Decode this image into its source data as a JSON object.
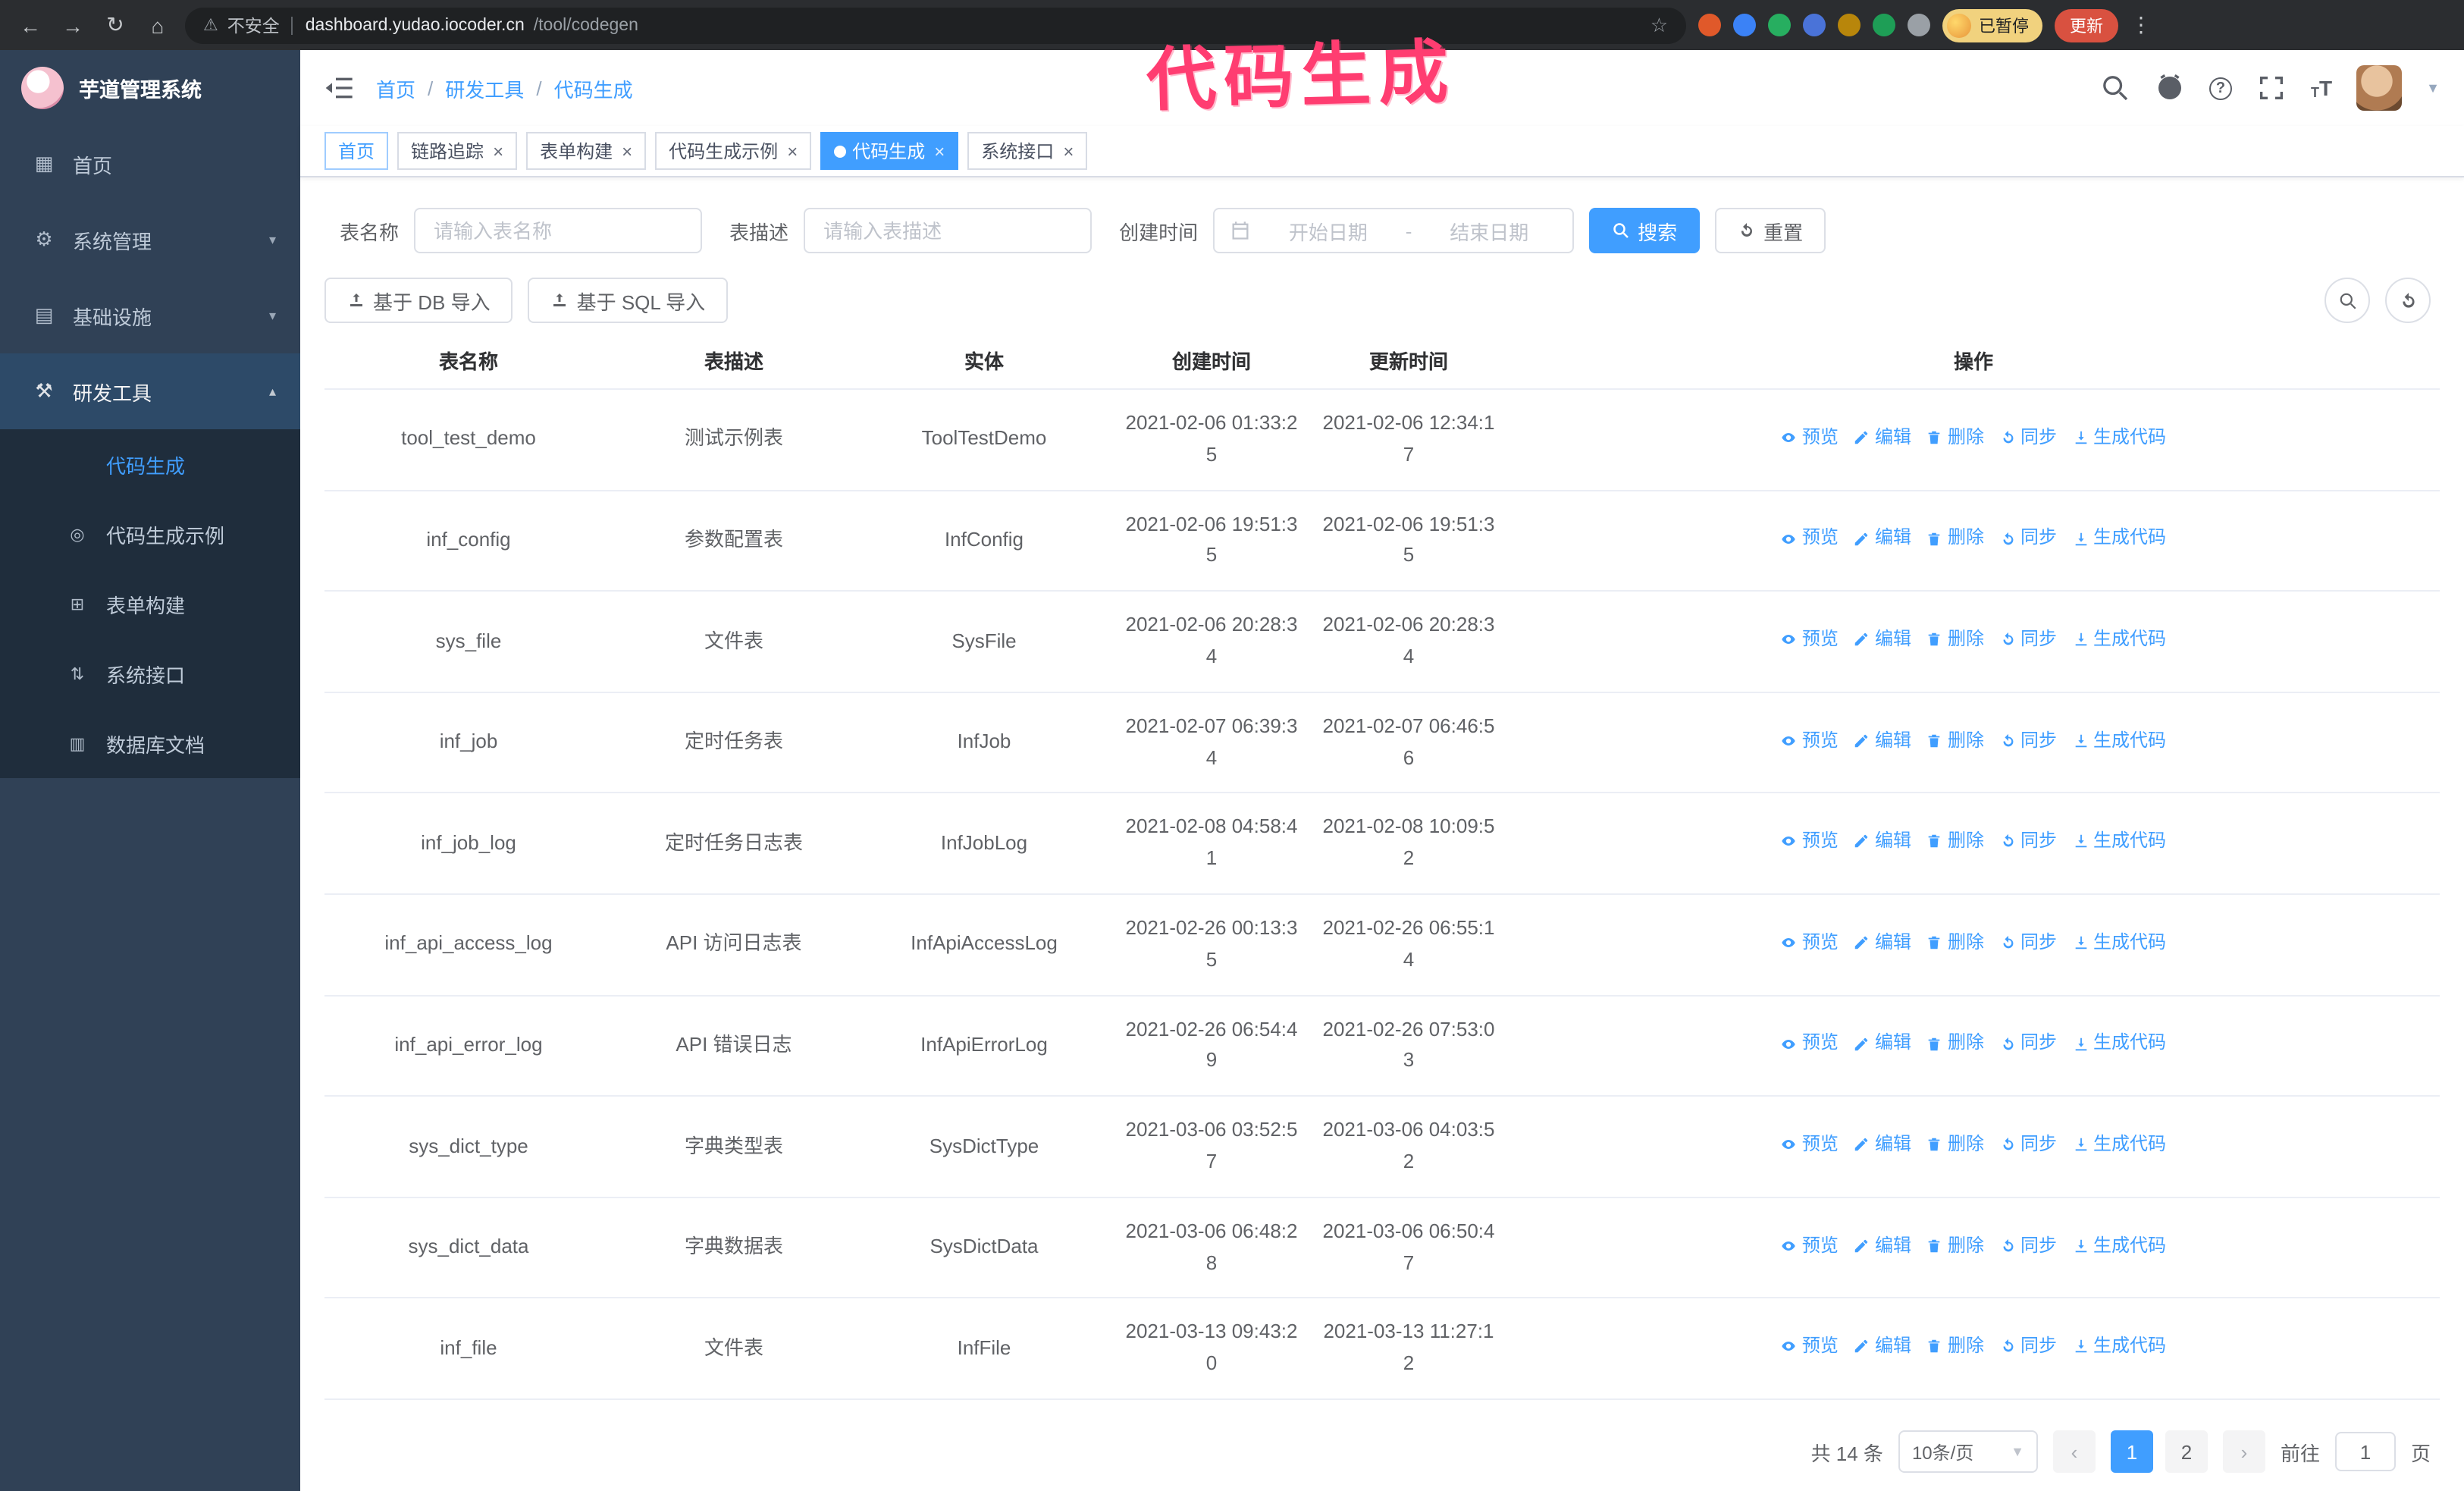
{
  "annotation": {
    "text": "代码生成"
  },
  "colors": {
    "primary": "#409eff",
    "sidebar_bg": "#304156",
    "submenu_bg": "#1f2d3c",
    "annotation": "#ff3d71"
  },
  "browser": {
    "security_label": "不安全",
    "url_host": "dashboard.yudao.iocoder.cn",
    "url_path": "/tool/codegen",
    "profile_badge": "已暂停",
    "update_label": "更新",
    "extensions": [
      {
        "name": "duckduckgo-extension-icon",
        "color": "#e0592a"
      },
      {
        "name": "blue-extension-icon",
        "color": "#3b82f6"
      },
      {
        "name": "green-check-extension-icon",
        "color": "#27ae60"
      },
      {
        "name": "users-extension-icon",
        "color": "#4a73d8"
      },
      {
        "name": "dark-extension-icon",
        "color": "#b8860b"
      },
      {
        "name": "leaf-extension-icon",
        "color": "#1e9e56"
      },
      {
        "name": "puzzle-extension-icon",
        "color": "#9aa0a6"
      }
    ]
  },
  "sidebar": {
    "logo_title": "芋道管理系统",
    "items": [
      {
        "id": "home",
        "label": "首页",
        "icon": "dashboard-icon",
        "type": "link"
      },
      {
        "id": "system",
        "label": "系统管理",
        "icon": "gear-icon",
        "type": "group",
        "state": "collapsed"
      },
      {
        "id": "infra",
        "label": "基础设施",
        "icon": "infra-icon",
        "type": "group",
        "state": "collapsed"
      },
      {
        "id": "dev-tools",
        "label": "研发工具",
        "icon": "tools-icon",
        "type": "group",
        "state": "expanded",
        "children": [
          {
            "id": "codegen",
            "label": "代码生成",
            "icon": "code-icon",
            "active": true
          },
          {
            "id": "codegen-example",
            "label": "代码生成示例",
            "icon": "example-icon"
          },
          {
            "id": "form-build",
            "label": "表单构建",
            "icon": "form-icon"
          },
          {
            "id": "system-api",
            "label": "系统接口",
            "icon": "api-icon"
          },
          {
            "id": "db-doc",
            "label": "数据库文档",
            "icon": "database-icon"
          }
        ]
      }
    ]
  },
  "navbar": {
    "breadcrumb": [
      "首页",
      "研发工具",
      "代码生成"
    ],
    "separator": "/"
  },
  "tags": [
    {
      "label": "首页",
      "state": "pinned",
      "closable": false
    },
    {
      "label": "链路追踪",
      "state": "default",
      "closable": true
    },
    {
      "label": "表单构建",
      "state": "default",
      "closable": true
    },
    {
      "label": "代码生成示例",
      "state": "default",
      "closable": true
    },
    {
      "label": "代码生成",
      "state": "active",
      "closable": true
    },
    {
      "label": "系统接口",
      "state": "default",
      "closable": true
    }
  ],
  "filters": {
    "name_label": "表名称",
    "name_placeholder": "请输入表名称",
    "desc_label": "表描述",
    "desc_placeholder": "请输入表描述",
    "time_label": "创建时间",
    "start_placeholder": "开始日期",
    "range_separator": "-",
    "end_placeholder": "结束日期",
    "search_label": "搜索",
    "reset_label": "重置"
  },
  "toolbar": {
    "import_db_label": "基于 DB 导入",
    "import_sql_label": "基于 SQL 导入"
  },
  "table": {
    "columns": [
      "表名称",
      "表描述",
      "实体",
      "创建时间",
      "更新时间",
      "操作"
    ],
    "actions": [
      {
        "label": "预览",
        "icon": "eye-icon"
      },
      {
        "label": "编辑",
        "icon": "edit-icon"
      },
      {
        "label": "删除",
        "icon": "delete-icon"
      },
      {
        "label": "同步",
        "icon": "sync-icon"
      },
      {
        "label": "生成代码",
        "icon": "download-icon"
      }
    ],
    "rows": [
      {
        "name": "tool_test_demo",
        "desc": "测试示例表",
        "entity": "ToolTestDemo",
        "created": "2021-02-06 01:33:25",
        "updated": "2021-02-06 12:34:17"
      },
      {
        "name": "inf_config",
        "desc": "参数配置表",
        "entity": "InfConfig",
        "created": "2021-02-06 19:51:35",
        "updated": "2021-02-06 19:51:35"
      },
      {
        "name": "sys_file",
        "desc": "文件表",
        "entity": "SysFile",
        "created": "2021-02-06 20:28:34",
        "updated": "2021-02-06 20:28:34"
      },
      {
        "name": "inf_job",
        "desc": "定时任务表",
        "entity": "InfJob",
        "created": "2021-02-07 06:39:34",
        "updated": "2021-02-07 06:46:56"
      },
      {
        "name": "inf_job_log",
        "desc": "定时任务日志表",
        "entity": "InfJobLog",
        "created": "2021-02-08 04:58:41",
        "updated": "2021-02-08 10:09:52"
      },
      {
        "name": "inf_api_access_log",
        "desc": "API 访问日志表",
        "entity": "InfApiAccessLog",
        "created": "2021-02-26 00:13:35",
        "updated": "2021-02-26 06:55:14"
      },
      {
        "name": "inf_api_error_log",
        "desc": "API 错误日志",
        "entity": "InfApiErrorLog",
        "created": "2021-02-26 06:54:49",
        "updated": "2021-02-26 07:53:03"
      },
      {
        "name": "sys_dict_type",
        "desc": "字典类型表",
        "entity": "SysDictType",
        "created": "2021-03-06 03:52:57",
        "updated": "2021-03-06 04:03:52"
      },
      {
        "name": "sys_dict_data",
        "desc": "字典数据表",
        "entity": "SysDictData",
        "created": "2021-03-06 06:48:28",
        "updated": "2021-03-06 06:50:47"
      },
      {
        "name": "inf_file",
        "desc": "文件表",
        "entity": "InfFile",
        "created": "2021-03-13 09:43:20",
        "updated": "2021-03-13 11:27:12"
      }
    ]
  },
  "pagination": {
    "total_label": "共 14 条",
    "page_size_label": "10条/页",
    "pages": [
      "1",
      "2"
    ],
    "active_page": "1",
    "goto_label": "前往",
    "goto_value": "1",
    "unit_label": "页"
  }
}
